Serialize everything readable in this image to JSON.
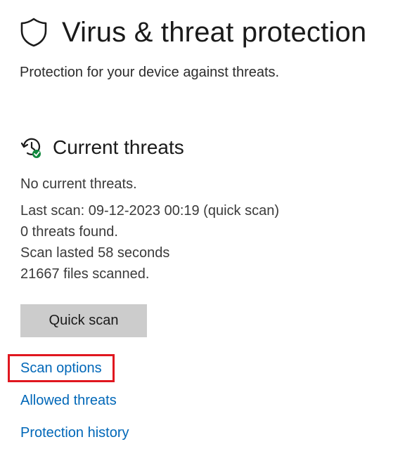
{
  "header": {
    "title": "Virus & threat protection",
    "subtitle": "Protection for your device against threats.",
    "icon": "shield-icon"
  },
  "current_threats": {
    "title": "Current threats",
    "icon": "history-check-icon",
    "status": "No current threats.",
    "details": [
      "Last scan: 09-12-2023 00:19 (quick scan)",
      "0 threats found.",
      "Scan lasted 58 seconds",
      "21667 files scanned."
    ],
    "quick_scan_label": "Quick scan"
  },
  "links": {
    "scan_options": "Scan options",
    "allowed_threats": "Allowed threats",
    "protection_history": "Protection history"
  },
  "colors": {
    "link": "#0067b8",
    "button_bg": "#cccccc",
    "highlight": "#e0171f",
    "status_ok": "#10893e"
  }
}
